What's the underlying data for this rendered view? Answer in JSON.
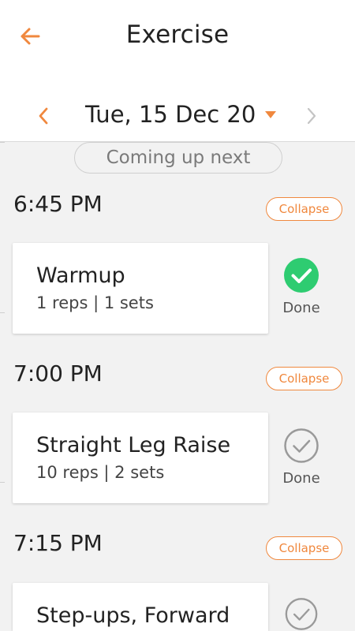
{
  "header": {
    "title": "Exercise"
  },
  "date_bar": {
    "date": "Tue, 15 Dec 20"
  },
  "coming_up": "Coming up next",
  "colors": {
    "accent": "#f0883e",
    "done_green": "#2ecc71",
    "pending_gray": "#9a9a9a"
  },
  "icons": {
    "back": "arrow-left-icon",
    "prev": "chevron-left-icon",
    "next": "chevron-right-icon",
    "caret": "caret-down-icon",
    "done": "check-circle-icon"
  },
  "groups": [
    {
      "time": "6:45 PM",
      "collapse_label": "Collapse",
      "exercise": {
        "name": "Warmup",
        "details": "1 reps | 1 sets",
        "done_label": "Done",
        "done": true
      }
    },
    {
      "time": "7:00 PM",
      "collapse_label": "Collapse",
      "exercise": {
        "name": "Straight Leg Raise",
        "details": "10 reps | 2 sets",
        "done_label": "Done",
        "done": false
      }
    },
    {
      "time": "7:15 PM",
      "collapse_label": "Collapse",
      "exercise": {
        "name": "Step-ups, Forward",
        "details": "",
        "done_label": "",
        "done": false
      }
    }
  ]
}
